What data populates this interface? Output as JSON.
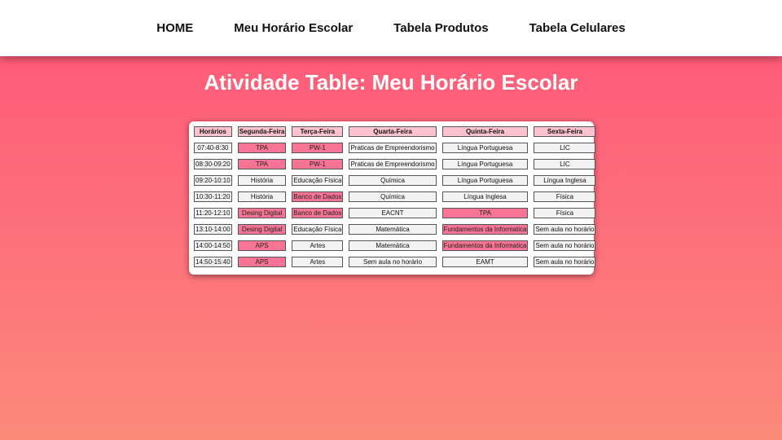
{
  "nav": {
    "items": [
      {
        "label": "HOME"
      },
      {
        "label": "Meu Horário Escolar"
      },
      {
        "label": "Tabela Produtos"
      },
      {
        "label": "Tabela Celulares"
      }
    ]
  },
  "page": {
    "title": "Atividade Table: Meu Horário Escolar"
  },
  "schedule": {
    "headers": [
      "Horários",
      "Segunda-Feira",
      "Terça-Feira",
      "Quarta-Feira",
      "Quinta-Feira",
      "Sexta-Feira"
    ],
    "highlight_color": "#f77494",
    "header_color": "#ffc3cf",
    "rows": [
      {
        "cells": [
          "07:40-8:30",
          "TPA",
          "PW-1",
          "Praticas de Empreendorismo",
          "Língua Portuguesa",
          "LIC"
        ],
        "highlight": [
          false,
          true,
          true,
          false,
          false,
          false
        ]
      },
      {
        "cells": [
          "08:30-09:20",
          "TPA",
          "PW-1",
          "Praticas de Empreendorismo",
          "Língua Portuguesa",
          "LIC"
        ],
        "highlight": [
          false,
          true,
          true,
          false,
          false,
          false
        ]
      },
      {
        "cells": [
          "09:20-10:10",
          "História",
          "Educação Física",
          "Química",
          "Língua Portuguesa",
          "Língua Inglesa"
        ],
        "highlight": [
          false,
          false,
          false,
          false,
          false,
          false
        ]
      },
      {
        "cells": [
          "10:30-11:20",
          "História",
          "Banco de Dados",
          "Química",
          "Língua Inglesa",
          "Física"
        ],
        "highlight": [
          false,
          false,
          true,
          false,
          false,
          false
        ]
      },
      {
        "cells": [
          "11:20-12:10",
          "Desing Digital",
          "Banco de Dados",
          "EACNT",
          "TPA",
          "Física"
        ],
        "highlight": [
          false,
          true,
          true,
          false,
          true,
          false
        ]
      },
      {
        "cells": [
          "13:10-14:00",
          "Desing Digital",
          "Educação Física",
          "Matemática",
          "Fundamentos da Informatica",
          "Sem aula no horário"
        ],
        "highlight": [
          false,
          true,
          false,
          false,
          true,
          false
        ]
      },
      {
        "cells": [
          "14:00-14:50",
          "APS",
          "Artes",
          "Matemática",
          "Fundamentos da Informatica",
          "Sem aula no horário"
        ],
        "highlight": [
          false,
          true,
          false,
          false,
          true,
          false
        ]
      },
      {
        "cells": [
          "14:50-15:40",
          "APS",
          "Artes",
          "Sem aula no horário",
          "EAMT",
          "Sem aula no horário"
        ],
        "highlight": [
          false,
          true,
          false,
          false,
          false,
          false
        ]
      }
    ]
  }
}
